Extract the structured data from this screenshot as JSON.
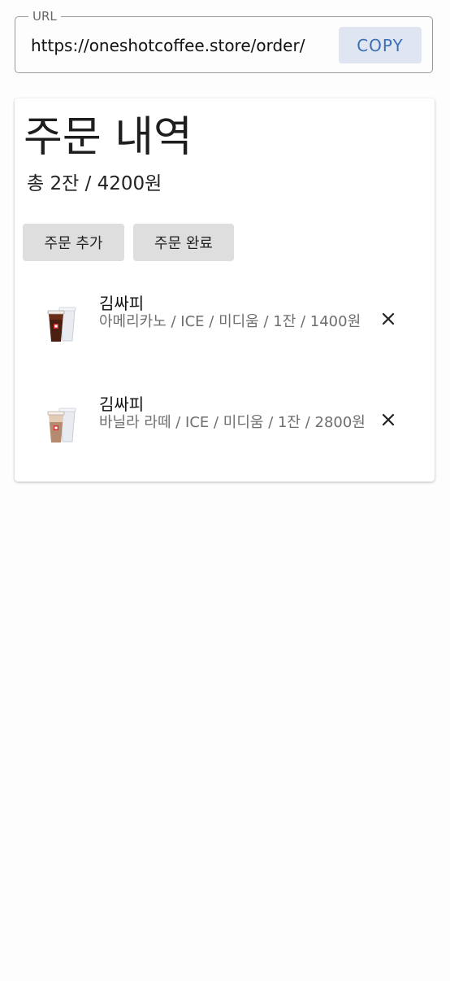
{
  "url_field": {
    "legend": "URL",
    "value": "https://oneshotcoffee.store/order/",
    "copy_label": "COPY"
  },
  "order": {
    "title": "주문 내역",
    "summary": "총 2잔 / 4200원",
    "add_label": "주문 추가",
    "complete_label": "주문 완료",
    "items": [
      {
        "name": "김싸피",
        "detail": "아메리카노 / ICE / 미디움 / 1잔 / 1400원",
        "thumb_icon": "iced-americano-icon"
      },
      {
        "name": "김싸피",
        "detail": "바닐라 라떼 / ICE / 미디움 / 1잔 / 2800원",
        "thumb_icon": "iced-vanilla-latte-icon"
      }
    ]
  },
  "colors": {
    "accent": "#3a6fb5",
    "copy_button_bg": "#dfe6f1",
    "action_button_bg": "#dedede"
  }
}
